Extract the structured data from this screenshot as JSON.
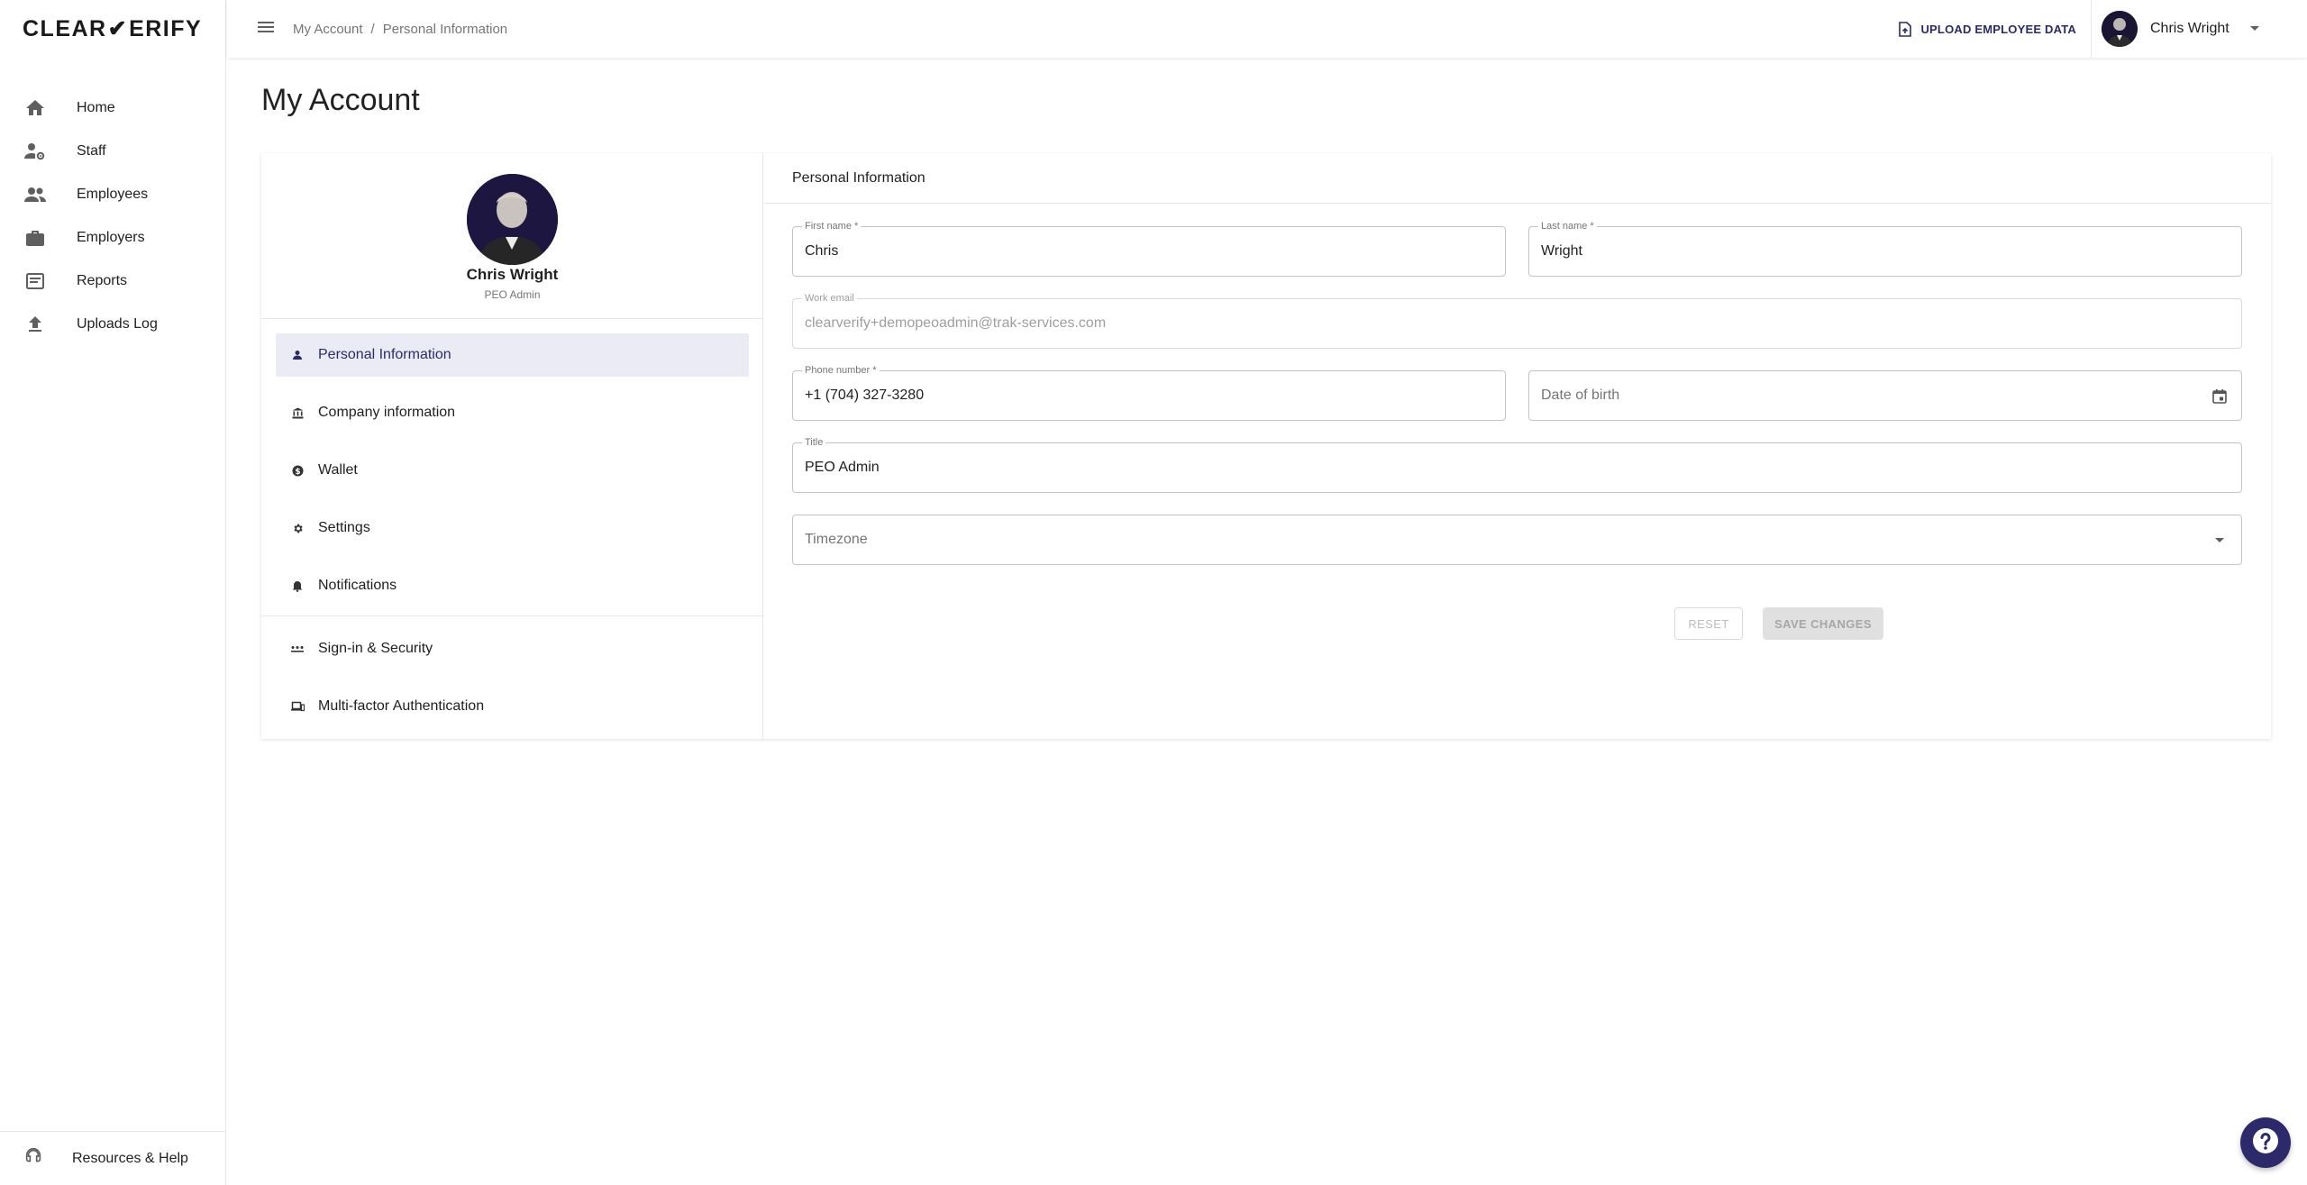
{
  "app": {
    "logo_left": "CLEAR",
    "logo_check": "✔",
    "logo_right": "ERIFY"
  },
  "sidebar": {
    "items": [
      {
        "label": "Home",
        "icon": "home-icon"
      },
      {
        "label": "Staff",
        "icon": "staff-icon"
      },
      {
        "label": "Employees",
        "icon": "employees-icon"
      },
      {
        "label": "Employers",
        "icon": "briefcase-icon"
      },
      {
        "label": "Reports",
        "icon": "reports-icon"
      },
      {
        "label": "Uploads Log",
        "icon": "upload-icon"
      }
    ],
    "footer_label": "Resources & Help"
  },
  "header": {
    "breadcrumb": [
      "My Account",
      "Personal Information"
    ],
    "breadcrumb_sep": "/",
    "upload_label": "UPLOAD EMPLOYEE DATA",
    "user_name": "Chris Wright"
  },
  "page": {
    "title": "My Account"
  },
  "profile": {
    "name": "Chris Wright",
    "role": "PEO Admin"
  },
  "account_menu": {
    "primary": [
      {
        "label": "Personal Information",
        "icon": "person-icon",
        "active": true
      },
      {
        "label": "Company information",
        "icon": "bank-icon",
        "active": false
      },
      {
        "label": "Wallet",
        "icon": "dollar-icon",
        "active": false
      },
      {
        "label": "Settings",
        "icon": "gear-icon",
        "active": false
      },
      {
        "label": "Notifications",
        "icon": "bell-icon",
        "active": false
      }
    ],
    "secondary": [
      {
        "label": "Sign-in & Security",
        "icon": "password-icon"
      },
      {
        "label": "Multi-factor Authentication",
        "icon": "devices-icon"
      }
    ]
  },
  "form": {
    "section_title": "Personal Information",
    "first_name": {
      "label": "First name *",
      "value": "Chris"
    },
    "last_name": {
      "label": "Last name *",
      "value": "Wright"
    },
    "work_email": {
      "label": "Work email",
      "value": "clearverify+demopeoadmin@trak-services.com"
    },
    "phone": {
      "label": "Phone number *",
      "value": "+1 (704) 327-3280"
    },
    "dob": {
      "placeholder": "Date of birth"
    },
    "title": {
      "label": "Title",
      "value": "PEO Admin"
    },
    "timezone": {
      "placeholder": "Timezone"
    },
    "reset_label": "RESET",
    "save_label": "SAVE CHANGES"
  },
  "colors": {
    "brand": "#2c2a6b",
    "active_bg": "#ebebf6"
  }
}
